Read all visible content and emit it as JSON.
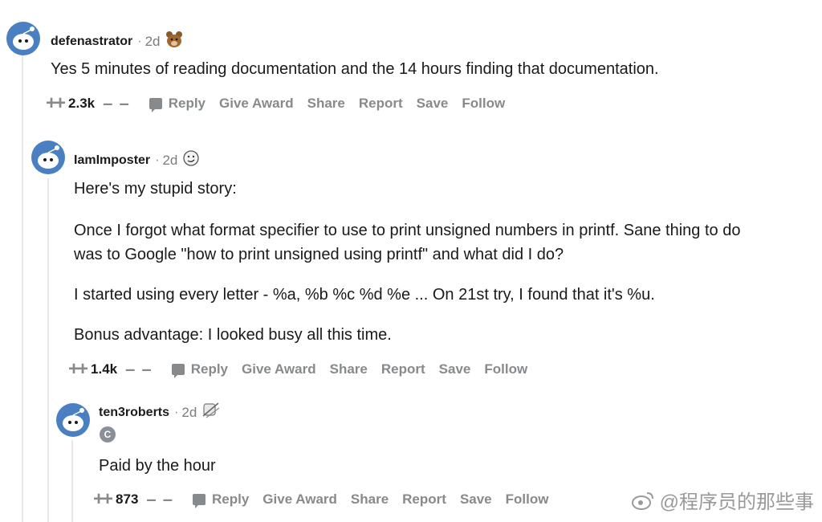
{
  "comments": [
    {
      "username": "defenastrator",
      "time": "2d",
      "flair_icon": "bear-award-icon",
      "body": [
        "Yes 5 minutes of reading documentation and the 14 hours finding that documentation."
      ],
      "score": "2.3k"
    },
    {
      "username": "IamImposter",
      "time": "2d",
      "flair_icon": "emoji-face-award-icon",
      "body": [
        "Here's my stupid story:",
        "Once I forgot what format specifier to use to print unsigned numbers in printf. Sane thing to do",
        "was to Google \"how to print unsigned using printf\" and what did I do?",
        "I started using every letter - %a, %b %c %d %e ... On 21st try, I found that it's %u.",
        "Bonus advantage: I looked busy all this time."
      ],
      "score": "1.4k"
    },
    {
      "username": "ten3roberts",
      "time": "2d",
      "flair_icon": "crossed-out-award-icon",
      "badge": "C",
      "body": [
        "Paid by the hour"
      ],
      "score": "873"
    }
  ],
  "actions": {
    "reply": "Reply",
    "give_award": "Give Award",
    "share": "Share",
    "report": "Report",
    "save": "Save",
    "follow": "Follow"
  },
  "separator": "·",
  "watermark": "@程序员的那些事",
  "colors": {
    "avatar_blue": "#4a7fc1",
    "muted_gray": "#878a8c",
    "thread_line": "#e6e8ea",
    "text": "#1a1a1b"
  }
}
